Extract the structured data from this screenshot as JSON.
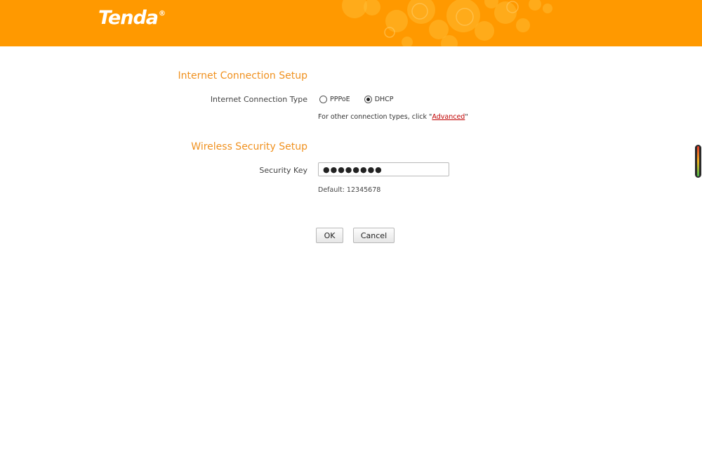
{
  "brand": {
    "logo_text": "Tenda",
    "logo_mark": "®",
    "color": "#ff9900"
  },
  "internet": {
    "section_title": "Internet Connection Setup",
    "type_label": "Internet Connection Type",
    "options": [
      {
        "label": "PPPoE",
        "selected": false
      },
      {
        "label": "DHCP",
        "selected": true
      }
    ],
    "hint_prefix": "For other connection types, click \"",
    "hint_link": "Advanced",
    "hint_suffix": "\""
  },
  "wireless": {
    "section_title": "Wireless Security Setup",
    "key_label": "Security Key",
    "key_value": "●●●●●●●●",
    "default_note": "Default: 12345678"
  },
  "actions": {
    "ok_label": "OK",
    "cancel_label": "Cancel"
  },
  "colors": {
    "accent": "#f0911f",
    "link": "#c00000"
  }
}
